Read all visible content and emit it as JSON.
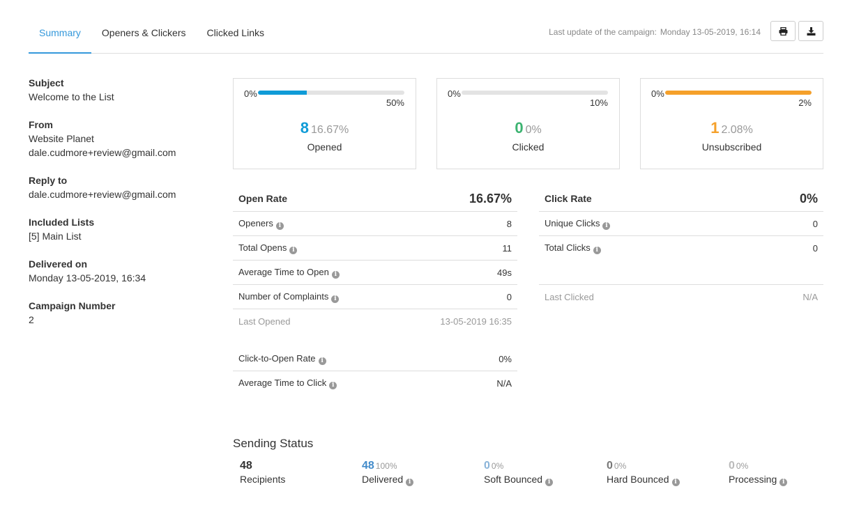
{
  "tabs": [
    {
      "label": "Summary",
      "active": true
    },
    {
      "label": "Openers & Clickers",
      "active": false
    },
    {
      "label": "Clicked Links",
      "active": false
    }
  ],
  "last_update": {
    "label": "Last update of the campaign:",
    "value": "Monday 13-05-2019, 16:14"
  },
  "header_buttons": [
    {
      "name": "print",
      "icon": "print-icon"
    },
    {
      "name": "download",
      "icon": "download-icon"
    }
  ],
  "info": {
    "subject_label": "Subject",
    "subject": "Welcome to the List",
    "from_label": "From",
    "from_name": "Website Planet",
    "from_email": "dale.cudmore+review@gmail.com",
    "reply_label": "Reply to",
    "reply_email": "dale.cudmore+review@gmail.com",
    "lists_label": "Included Lists",
    "lists": "[5] Main List",
    "delivered_label": "Delivered on",
    "delivered": "Monday 13-05-2019, 16:34",
    "campaign_label": "Campaign Number",
    "campaign_number": "2"
  },
  "cards": [
    {
      "min": "0%",
      "max": "50%",
      "fill_fraction": 0.3334,
      "count": "8",
      "pct": "16.67%",
      "label": "Opened",
      "color": "#0f9bd7"
    },
    {
      "min": "0%",
      "max": "10%",
      "fill_fraction": 0,
      "count": "0",
      "pct": "0%",
      "label": "Clicked",
      "color": "#3cb371"
    },
    {
      "min": "0%",
      "max": "2%",
      "fill_fraction": 1,
      "count": "1",
      "pct": "2.08%",
      "label": "Unsubscribed",
      "color": "#f5a02a"
    }
  ],
  "open_stats": {
    "title": "Open Rate",
    "value": "16.67%",
    "rows": [
      {
        "label": "Openers",
        "value": "8"
      },
      {
        "label": "Total Opens",
        "value": "11"
      },
      {
        "label": "Average Time to Open",
        "value": "49s"
      },
      {
        "label": "Number of Complaints",
        "value": "0"
      }
    ],
    "last_label": "Last Opened",
    "last_value": "13-05-2019 16:35",
    "extra_rows": [
      {
        "label": "Click-to-Open Rate",
        "value": "0%"
      },
      {
        "label": "Average Time to Click",
        "value": "N/A"
      }
    ]
  },
  "click_stats": {
    "title": "Click Rate",
    "value": "0%",
    "rows": [
      {
        "label": "Unique Clicks",
        "value": "0"
      },
      {
        "label": "Total Clicks",
        "value": "0"
      }
    ],
    "last_label": "Last Clicked",
    "last_value": "N/A"
  },
  "sending_status": {
    "title": "Sending Status",
    "items": [
      {
        "count": "48",
        "pct": "",
        "label": "Recipients",
        "color": "#333333",
        "info": false
      },
      {
        "count": "48",
        "pct": "100%",
        "label": "Delivered",
        "color": "#428bca",
        "info": true
      },
      {
        "count": "0",
        "pct": "0%",
        "label": "Soft Bounced",
        "color": "#8ab4d9",
        "info": true
      },
      {
        "count": "0",
        "pct": "0%",
        "label": "Hard Bounced",
        "color": "#777777",
        "info": true
      },
      {
        "count": "0",
        "pct": "0%",
        "label": "Processing",
        "color": "#bbbbbb",
        "info": true
      }
    ]
  }
}
